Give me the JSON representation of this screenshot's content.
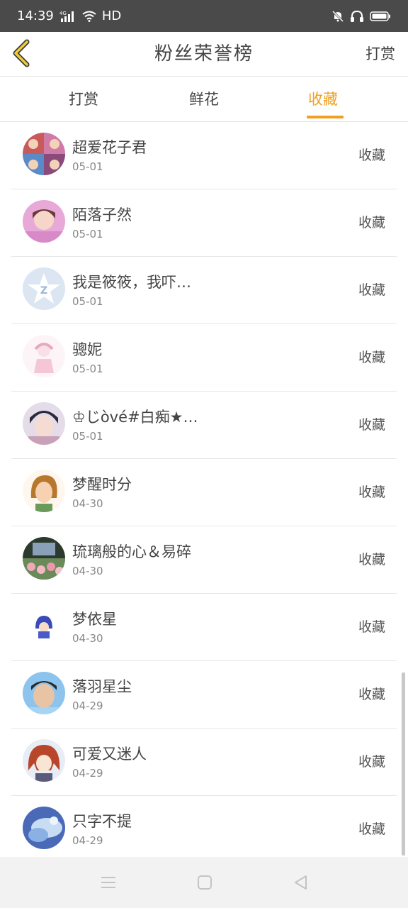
{
  "status_bar": {
    "time": "14:39",
    "network": "4G",
    "hd": "HD"
  },
  "header": {
    "title": "粉丝荣誉榜",
    "action_label": "打赏"
  },
  "tabs": [
    {
      "label": "打赏",
      "active": false
    },
    {
      "label": "鲜花",
      "active": false
    },
    {
      "label": "收藏",
      "active": true
    }
  ],
  "accent_color": "#f0a020",
  "list": [
    {
      "name": "超爱花子君",
      "date": "05-01",
      "action": "收藏"
    },
    {
      "name": "陌落子然",
      "date": "05-01",
      "action": "收藏"
    },
    {
      "name": "我是筱筱，我吓…",
      "date": "05-01",
      "action": "收藏"
    },
    {
      "name": "骢妮",
      "date": "05-01",
      "action": "收藏"
    },
    {
      "name": "♔じòvé#白痴★…",
      "date": "05-01",
      "action": "收藏"
    },
    {
      "name": "梦醒时分",
      "date": "04-30",
      "action": "收藏"
    },
    {
      "name": "琉璃般的心＆易碎",
      "date": "04-30",
      "action": "收藏"
    },
    {
      "name": "梦依星",
      "date": "04-30",
      "action": "收藏"
    },
    {
      "name": "落羽星尘",
      "date": "04-29",
      "action": "收藏"
    },
    {
      "name": "可爱又迷人",
      "date": "04-29",
      "action": "收藏"
    },
    {
      "name": "只字不提",
      "date": "04-29",
      "action": "收藏"
    }
  ]
}
